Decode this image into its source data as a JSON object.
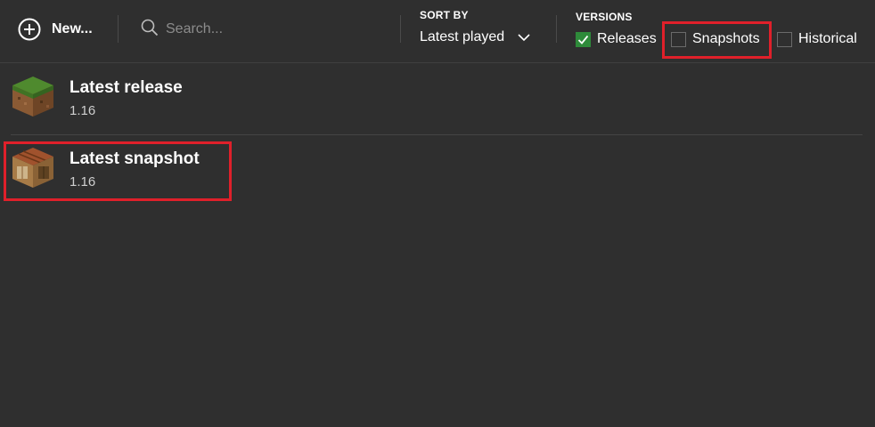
{
  "toolbar": {
    "new_label": "New...",
    "search_placeholder": "Search...",
    "sort_heading": "SORT BY",
    "sort_value": "Latest played",
    "versions_heading": "VERSIONS",
    "versions": [
      {
        "label": "Releases",
        "checked": true
      },
      {
        "label": "Snapshots",
        "checked": false
      },
      {
        "label": "Historical",
        "checked": false
      }
    ]
  },
  "installations": [
    {
      "name": "Latest release",
      "version": "1.16",
      "icon": "grass-block-icon"
    },
    {
      "name": "Latest snapshot",
      "version": "1.16",
      "icon": "crafting-table-icon"
    }
  ],
  "colors": {
    "background": "#2f2f2f",
    "checkbox_checked": "#2e8b3a",
    "highlight": "#e0202a"
  }
}
